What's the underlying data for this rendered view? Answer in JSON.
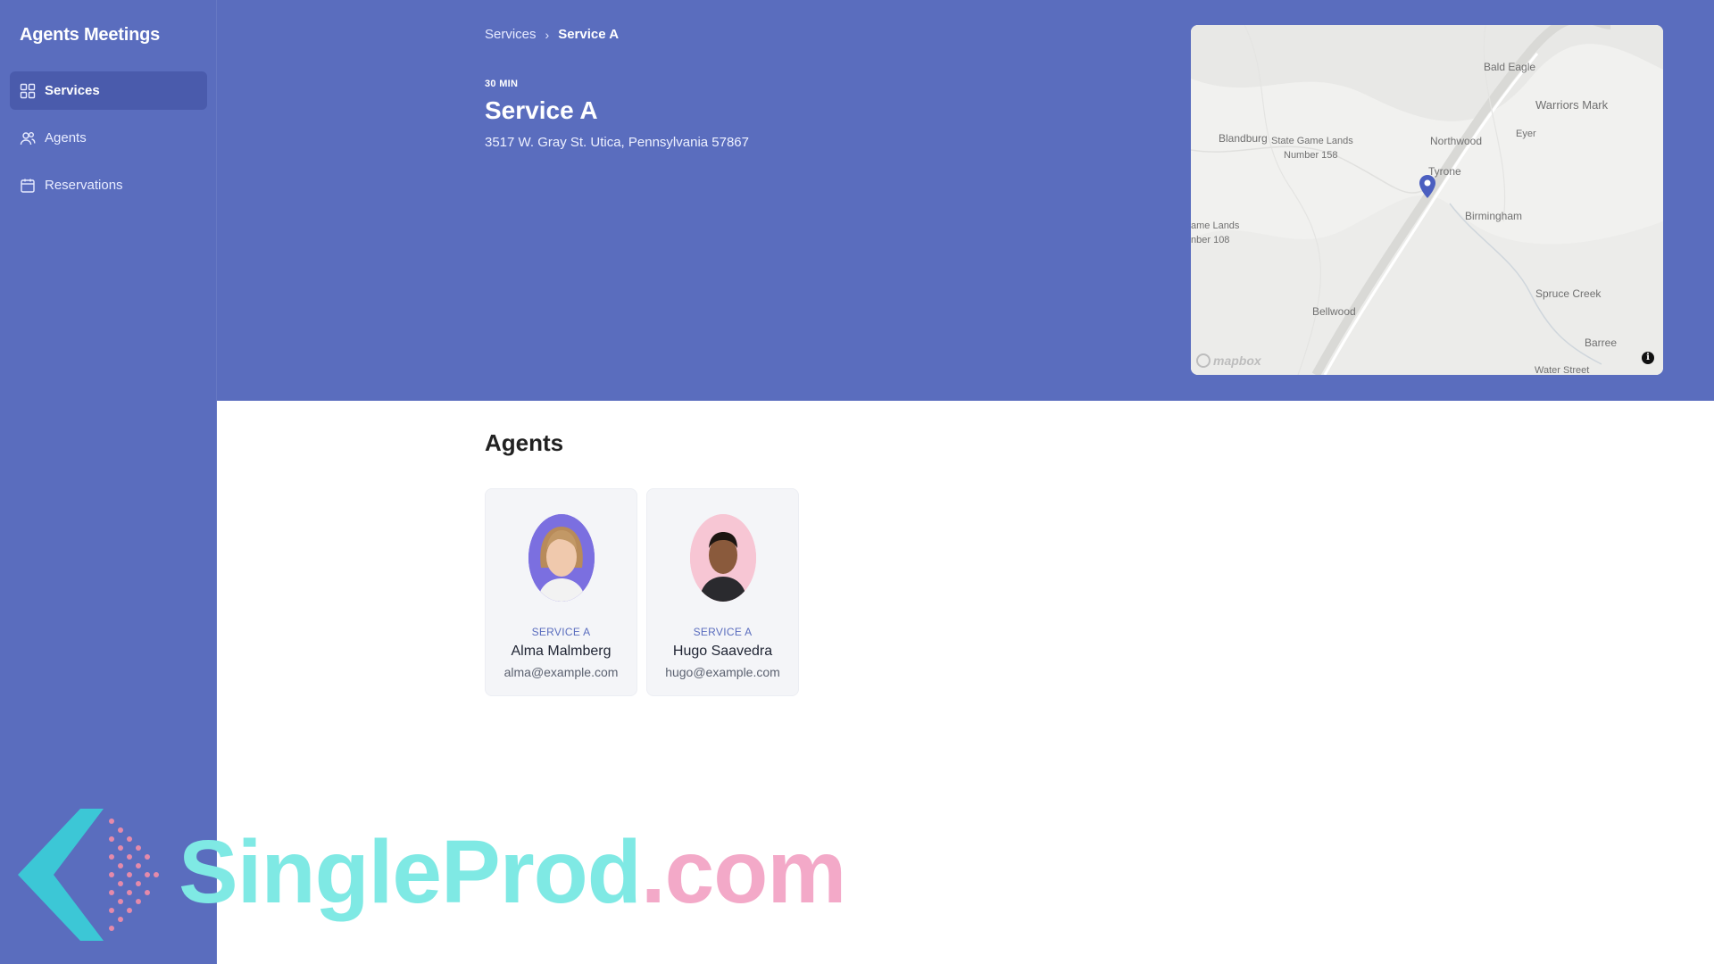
{
  "app": {
    "title": "Agents Meetings"
  },
  "sidebar": {
    "items": [
      {
        "label": "Services",
        "icon": "grid-icon",
        "active": true
      },
      {
        "label": "Agents",
        "icon": "users-icon",
        "active": false
      },
      {
        "label": "Reservations",
        "icon": "calendar-icon",
        "active": false
      }
    ]
  },
  "breadcrumb": {
    "parent": "Services",
    "separator": "›",
    "current": "Service A"
  },
  "service": {
    "duration": "30 MIN",
    "title": "Service A",
    "address": "3517 W. Gray St. Utica, Pennsylvania 57867"
  },
  "map": {
    "labels": {
      "bald_eagle": "Bald Eagle",
      "warriors_mark": "Warriors Mark",
      "blandburg": "Blandburg",
      "state_game_lands_1": "State Game Lands",
      "number_158": "Number 158",
      "northwood": "Northwood",
      "eyer": "Eyer",
      "tyrone": "Tyrone",
      "birmingham": "Birmingham",
      "game_lands_cut": "ame Lands",
      "number_108_cut": "nber 108",
      "spruce_creek": "Spruce Creek",
      "bellwood": "Bellwood",
      "barree": "Barree",
      "water_street": "Water Street"
    },
    "attribution": "mapbox",
    "info_glyph": "i"
  },
  "agents_section": {
    "title": "Agents",
    "agents": [
      {
        "service": "SERVICE A",
        "name": "Alma Malmberg",
        "email": "alma@example.com",
        "avatar_bg": "#7b6fe0"
      },
      {
        "service": "SERVICE A",
        "name": "Hugo Saavedra",
        "email": "hugo@example.com",
        "avatar_bg": "#f7c6d4"
      }
    ]
  },
  "watermark": {
    "part1": "SingleProd",
    "part2": ".com"
  },
  "colors": {
    "brand": "#5a6dbe",
    "sidebar_active": "#4a5bac",
    "accent_text": "#5a6dbe"
  }
}
